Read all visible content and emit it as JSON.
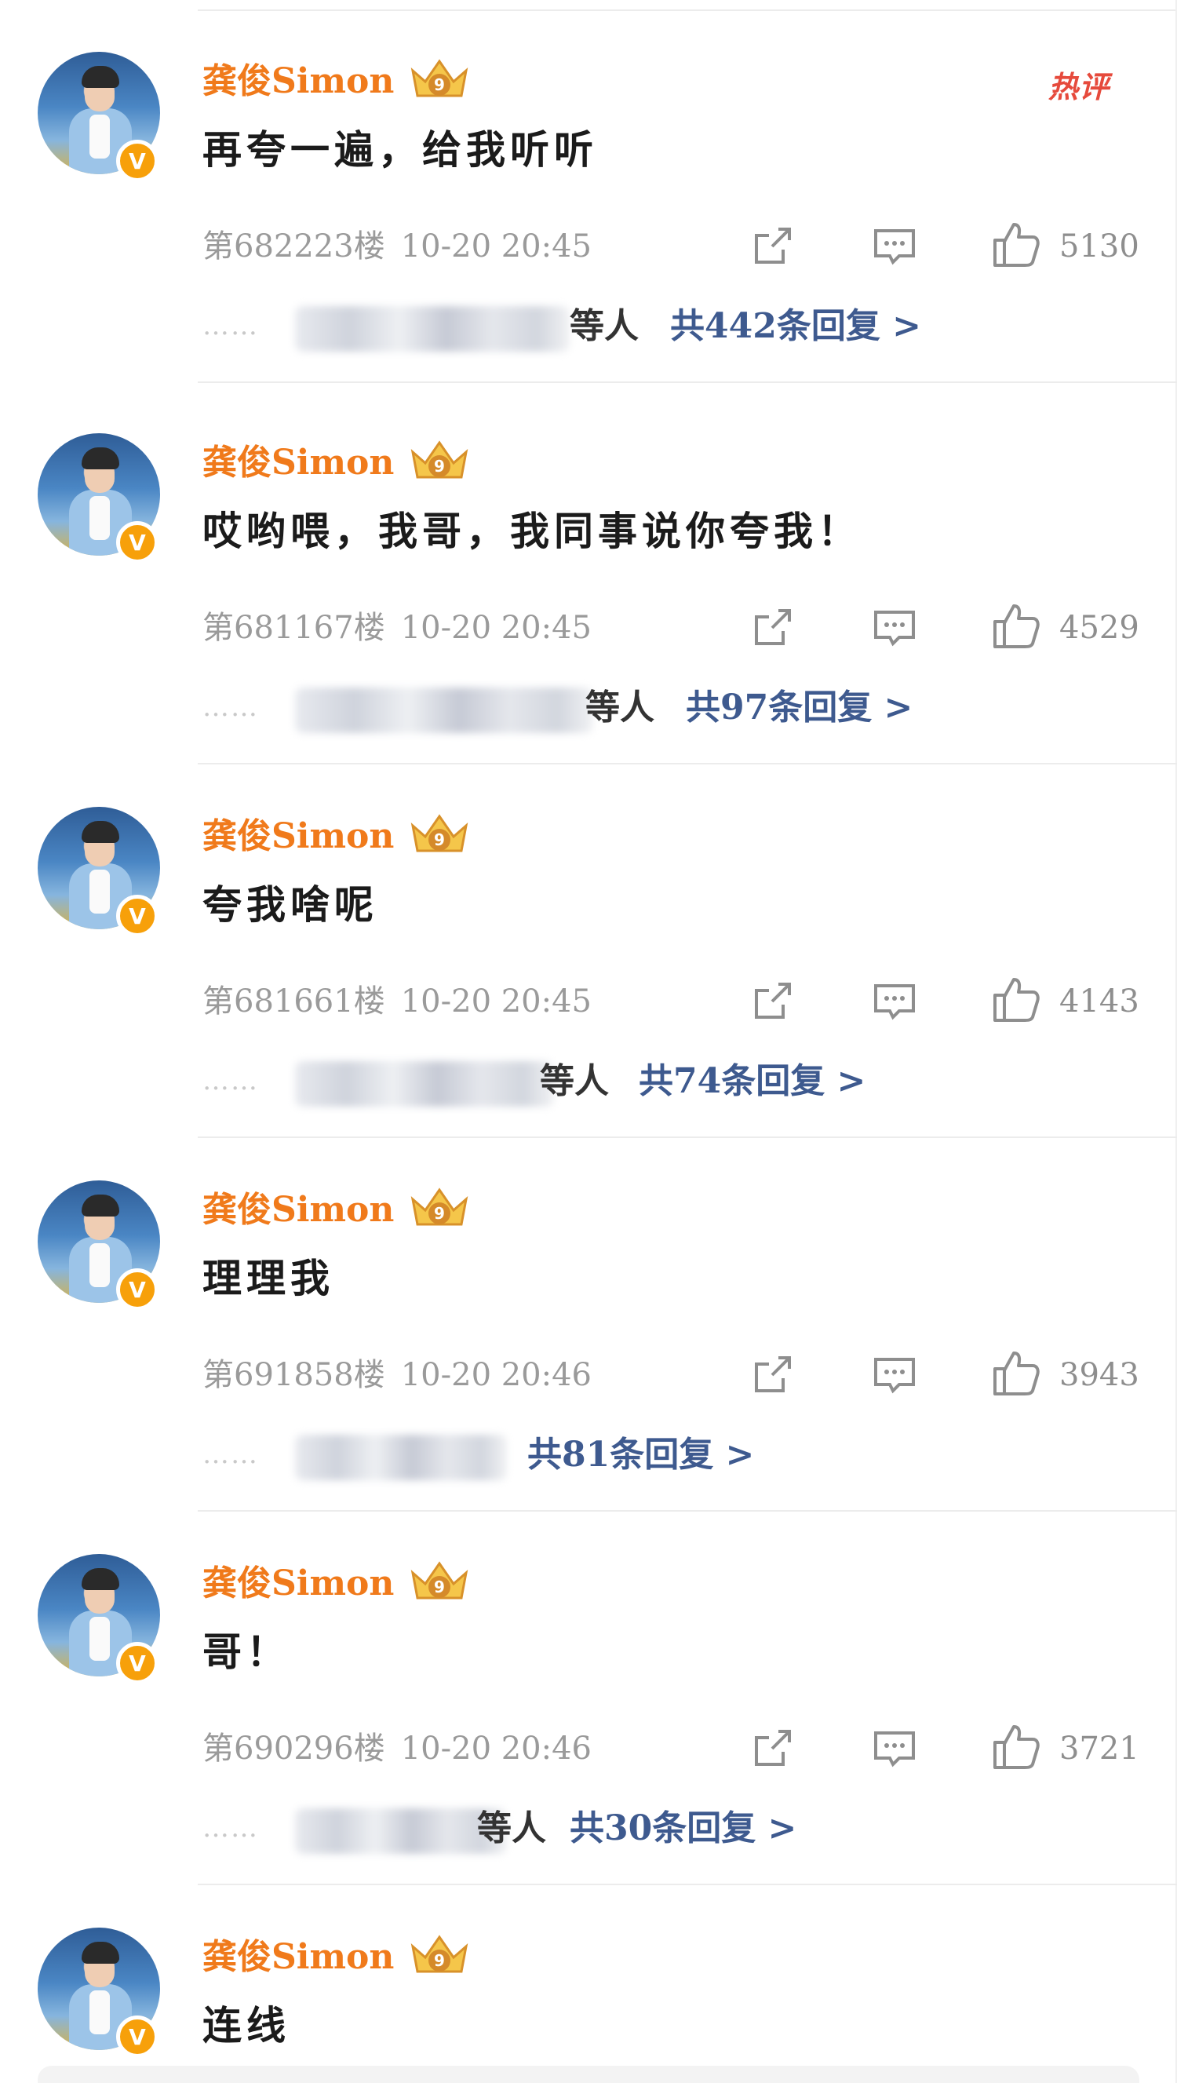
{
  "user": {
    "name": "龚俊Simon",
    "badge_level": "9",
    "verified_mark": "V"
  },
  "hot_badge": "热评",
  "colors": {
    "name": "#f07a1b",
    "reply_link": "#3e5a8f",
    "meta": "#9a9a9a",
    "hot": "#e64a3c",
    "verified": "#f7a00a"
  },
  "icons": {
    "share": "share-icon",
    "comment": "comment-icon",
    "like": "thumbs-up-icon",
    "crown": "crown-badge-icon"
  },
  "comments": [
    {
      "text": "再夸一遍，给我听听",
      "floor": "第682223楼",
      "time": "10-20 20:45",
      "likes": "5130",
      "reply_dots": "……",
      "reply_suffix": "等人",
      "reply_link": "共442条回复 >"
    },
    {
      "text": "哎哟喂，我哥，我同事说你夸我！",
      "floor": "第681167楼",
      "time": "10-20 20:45",
      "likes": "4529",
      "reply_dots": "……",
      "reply_suffix": "等人",
      "reply_link": "共97条回复 >"
    },
    {
      "text": "夸我啥呢",
      "floor": "第681661楼",
      "time": "10-20 20:45",
      "likes": "4143",
      "reply_dots": "……",
      "reply_suffix": "等人",
      "reply_link": "共74条回复 >"
    },
    {
      "text": "理理我",
      "floor": "第691858楼",
      "time": "10-20 20:46",
      "likes": "3943",
      "reply_dots": "……",
      "reply_suffix": "",
      "reply_link": "共81条回复 >"
    },
    {
      "text": "哥！",
      "floor": "第690296楼",
      "time": "10-20 20:46",
      "likes": "3721",
      "reply_dots": "……",
      "reply_suffix": "等人",
      "reply_link": "共30条回复 >"
    },
    {
      "text": "连线"
    }
  ]
}
